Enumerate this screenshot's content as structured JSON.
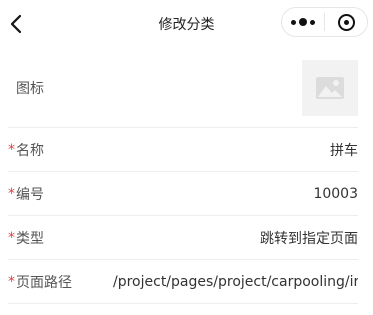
{
  "nav": {
    "title": "修改分类",
    "back_icon": "chevron-left-icon",
    "more_icon": "more-dots-icon",
    "close_icon": "target-close-icon"
  },
  "form": {
    "icon_label": "图标",
    "icon_placeholder": "image-placeholder-icon",
    "fields": [
      {
        "label": "名称",
        "required": true,
        "value": "拼车"
      },
      {
        "label": "编号",
        "required": true,
        "value": "10003"
      },
      {
        "label": "类型",
        "required": true,
        "value": "跳转到指定页面"
      },
      {
        "label": "页面路径",
        "required": true,
        "value": "/project/pages/project/carpooling/ir"
      }
    ],
    "required_mark": "*"
  },
  "colors": {
    "required": "#e04343",
    "divider": "#eeeeee",
    "placeholder_bg": "#f2f2f2"
  }
}
